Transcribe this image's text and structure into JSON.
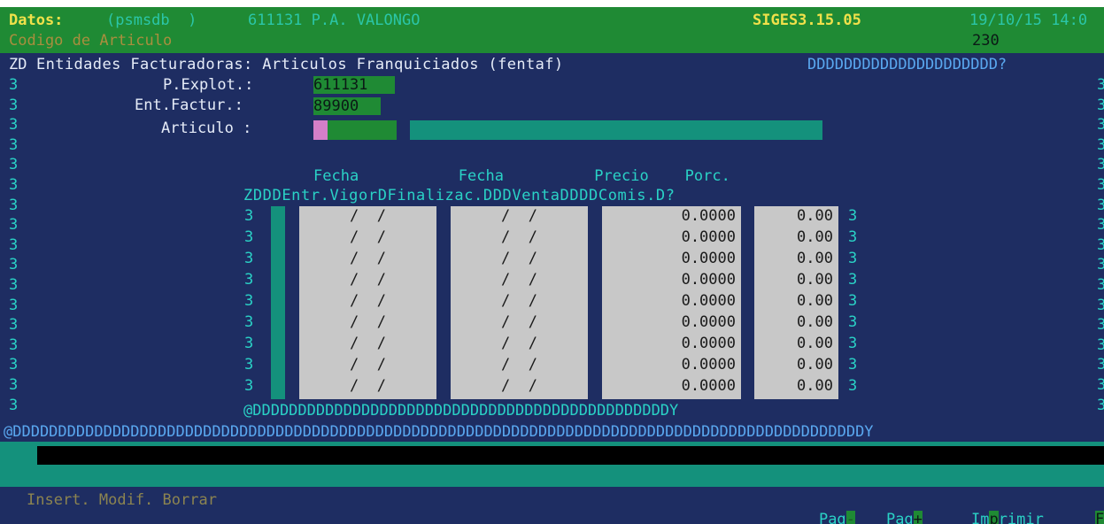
{
  "header": {
    "datos_label": "Datos:",
    "db": "(psmsdb  )",
    "center": "611131 P.A. VALONGO",
    "version": "SIGES3.15.05",
    "datetime": "19/10/15 14:0",
    "field_label": "Codigo de Articulo",
    "field_value": "230"
  },
  "title_line": {
    "prefix": "ZD",
    "title": "Entidades Facturadoras: Articulos Franquiciados (fentaf)",
    "suffix": "DDDDDDDDDDDDDDDDDDDDD?"
  },
  "left_border": [
    "3",
    "3",
    "3",
    "3",
    "3",
    "3",
    "3",
    "3",
    "3",
    "3",
    "3",
    "3",
    "3",
    "3",
    "3",
    "3",
    "3"
  ],
  "form": {
    "pexplot_label": "P.Explot.:",
    "pexplot_value": "611131",
    "entfactur_label": "Ent.Factur.:",
    "entfactur_value": "89900",
    "articulo_label": "Articulo :"
  },
  "table": {
    "header_row1": "Fecha           Fecha          Precio    Porc.",
    "header_row2": "ZDDDEntr.VigorDFinalizac.DDDVentaDDDDComis.D?",
    "rows": [
      {
        "left": "3",
        "fecha_ini": "/  /",
        "fecha_fin": "/  /",
        "precio": "0.0000",
        "comis": "0.00",
        "right": "3"
      },
      {
        "left": "3",
        "fecha_ini": "/  /",
        "fecha_fin": "/  /",
        "precio": "0.0000",
        "comis": "0.00",
        "right": "3"
      },
      {
        "left": "3",
        "fecha_ini": "/  /",
        "fecha_fin": "/  /",
        "precio": "0.0000",
        "comis": "0.00",
        "right": "3"
      },
      {
        "left": "3",
        "fecha_ini": "/  /",
        "fecha_fin": "/  /",
        "precio": "0.0000",
        "comis": "0.00",
        "right": "3"
      },
      {
        "left": "3",
        "fecha_ini": "/  /",
        "fecha_fin": "/  /",
        "precio": "0.0000",
        "comis": "0.00",
        "right": "3"
      },
      {
        "left": "3",
        "fecha_ini": "/  /",
        "fecha_fin": "/  /",
        "precio": "0.0000",
        "comis": "0.00",
        "right": "3"
      },
      {
        "left": "3",
        "fecha_ini": "/  /",
        "fecha_fin": "/  /",
        "precio": "0.0000",
        "comis": "0.00",
        "right": "3"
      },
      {
        "left": "3",
        "fecha_ini": "/  /",
        "fecha_fin": "/  /",
        "precio": "0.0000",
        "comis": "0.00",
        "right": "3"
      },
      {
        "left": "3",
        "fecha_ini": "/  /",
        "fecha_fin": "/  /",
        "precio": "0.0000",
        "comis": "0.00",
        "right": "3"
      }
    ],
    "footer": "@DDDDDDDDDDDDDDDDDDDDDDDDDDDDDDDDDDDDDDDDDDDDDDY"
  },
  "bottom_border": "@DDDDDDDDDDDDDDDDDDDDDDDDDDDDDDDDDDDDDDDDDDDDDDDDDDDDDDDDDDDDDDDDDDDDDDDDDDDDDDDDDDDDDDDDDDDDDDY",
  "footer": {
    "actions": "Insert. Modif. Borrar",
    "pag_minus_a": "Pag",
    "pag_minus_b": "-",
    "pag_plus_a": "Pag",
    "pag_plus_b": "+",
    "imprimir_a": "Im",
    "imprimir_b": "p",
    "imprimir_c": "rimir",
    "fin_a": "F",
    "fin_b": "IN"
  },
  "colors": {
    "screen_bg": "#1e2d62",
    "header_green": "#1f8a34",
    "teal": "#14917c",
    "cyan_text": "#2ad2c6",
    "cell_grey": "#c8c8c8",
    "highlight_pink": "#d47fc8"
  }
}
